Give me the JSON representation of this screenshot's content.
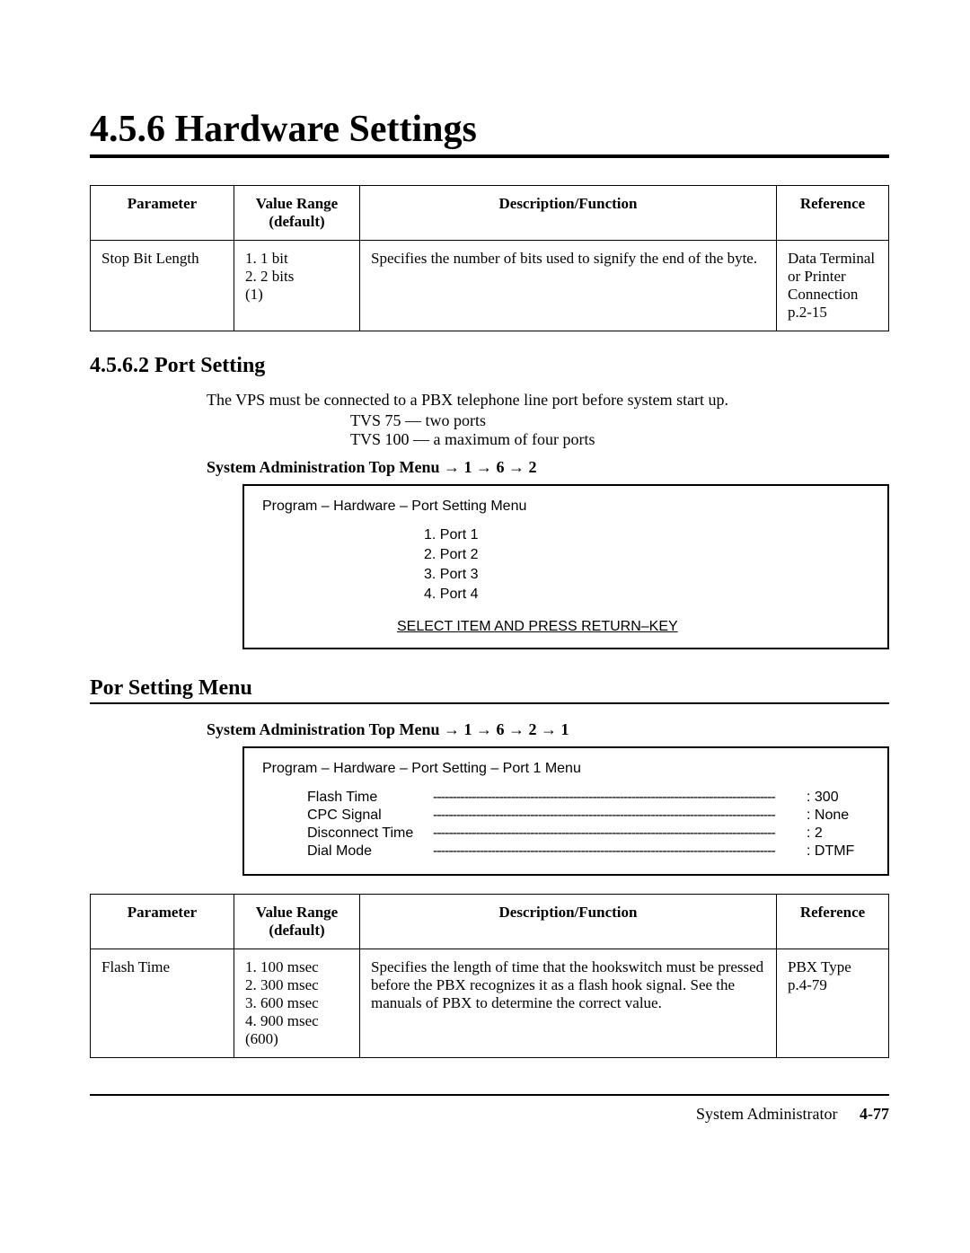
{
  "page_title": "4.5.6   Hardware Settings",
  "table1": {
    "headers": {
      "param": "Parameter",
      "vr": "Value Range (default)",
      "desc": "Description/Function",
      "ref": "Reference"
    },
    "row": {
      "param": "Stop Bit Length",
      "vr": "1. 1 bit\n2. 2 bits\n(1)",
      "desc": "Specifies the number of bits used to signify the end of the byte.",
      "ref": "Data Terminal or Printer Connection p.2-15"
    }
  },
  "subsection_4562": "4.5.6.2  Port Setting",
  "ps_intro": "The VPS must be connected to a PBX telephone line port before system start up.",
  "tvs75": "TVS 75   — two ports",
  "tvs100": "TVS 100 — a maximum of four ports",
  "nav_path1": "System Administration Top Menu → 1 → 6 → 2",
  "menu1": {
    "title": "Program – Hardware – Port Setting Menu",
    "items": [
      "1.  Port 1",
      "2.  Port 2",
      "3.  Port 3",
      "4.  Port 4"
    ],
    "select": "SELECT ITEM AND PRESS RETURN–KEY"
  },
  "port_setting_menu_heading": "Por   Setting Menu",
  "nav_path2": "System Administration Top Menu → 1 → 6 → 2 → 1",
  "menu2": {
    "title": "Program – Hardware – Port Setting – Port 1 Menu",
    "settings": [
      {
        "label": "Flash Time",
        "val": ":  300"
      },
      {
        "label": "CPC Signal",
        "val": ":  None"
      },
      {
        "label": "Disconnect Time",
        "val": ":  2"
      },
      {
        "label": "Dial Mode",
        "val": ":  DTMF"
      }
    ]
  },
  "table2": {
    "row": {
      "param": "Flash Time",
      "vr": "1. 100 msec\n2. 300 msec\n3. 600 msec\n4. 900 msec\n(600)",
      "desc": "Specifies the length of time that the hookswitch must be pressed before the PBX recognizes it as a flash hook signal.  See the manuals of PBX to determine the correct value.",
      "ref": "PBX Type p.4-79"
    }
  },
  "footer_text": "System Administrator",
  "footer_page": "4-77"
}
